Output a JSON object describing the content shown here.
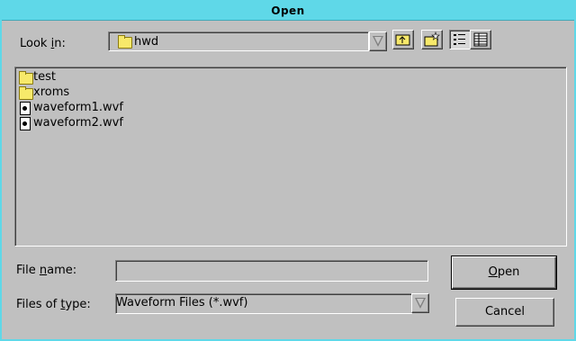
{
  "window": {
    "title": "Open"
  },
  "lookin": {
    "label_pre": "Look ",
    "label_ul": "i",
    "label_post": "n:",
    "value": "hwd"
  },
  "files": [
    {
      "name": "test",
      "type": "folder"
    },
    {
      "name": "xroms",
      "type": "folder"
    },
    {
      "name": "waveform1.wvf",
      "type": "file"
    },
    {
      "name": "waveform2.wvf",
      "type": "file"
    }
  ],
  "filename": {
    "label_pre": "File ",
    "label_ul": "n",
    "label_post": "ame:",
    "value": ""
  },
  "filetype": {
    "label_pre": "Files of ",
    "label_ul": "t",
    "label_post": "ype:",
    "value": "Waveform Files (*.wvf)"
  },
  "buttons": {
    "open_ul": "O",
    "open_rest": "pen",
    "cancel": "Cancel"
  },
  "icons": [
    "folder-icon",
    "up-folder-icon",
    "new-folder-icon",
    "list-view-icon",
    "details-view-icon",
    "dropdown-arrow-icon",
    "file-icon"
  ],
  "colors": {
    "titlebar": "#5fd8e8",
    "face": "#c0c0c0",
    "folder": "#f7e96a"
  }
}
